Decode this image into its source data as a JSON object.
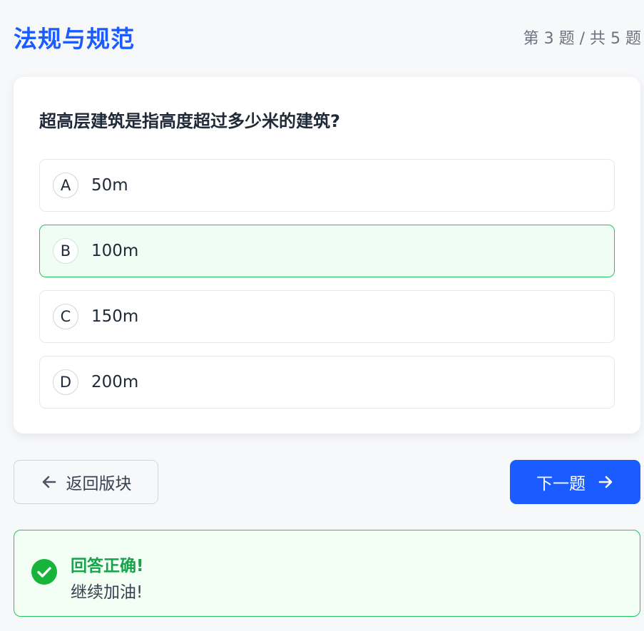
{
  "header": {
    "section_title": "法规与规范",
    "progress_text": "第 3 题 / 共 5 题"
  },
  "question": {
    "text": "超高层建筑是指高度超过多少米的建筑?",
    "options": [
      {
        "letter": "A",
        "text": "50m"
      },
      {
        "letter": "B",
        "text": "100m"
      },
      {
        "letter": "C",
        "text": "150m"
      },
      {
        "letter": "D",
        "text": "200m"
      }
    ],
    "selected": "B"
  },
  "nav": {
    "back_label": "返回版块",
    "back_icon": "arrow-left-icon",
    "next_label": "下一题",
    "next_icon": "arrow-right-icon"
  },
  "feedback": {
    "title": "回答正确!",
    "subtitle": "继续加油!",
    "icon": "check-circle-icon"
  },
  "colors": {
    "accent": "#1a5cff",
    "success": "#16a34a",
    "success_bg": "#f0fdf4"
  }
}
